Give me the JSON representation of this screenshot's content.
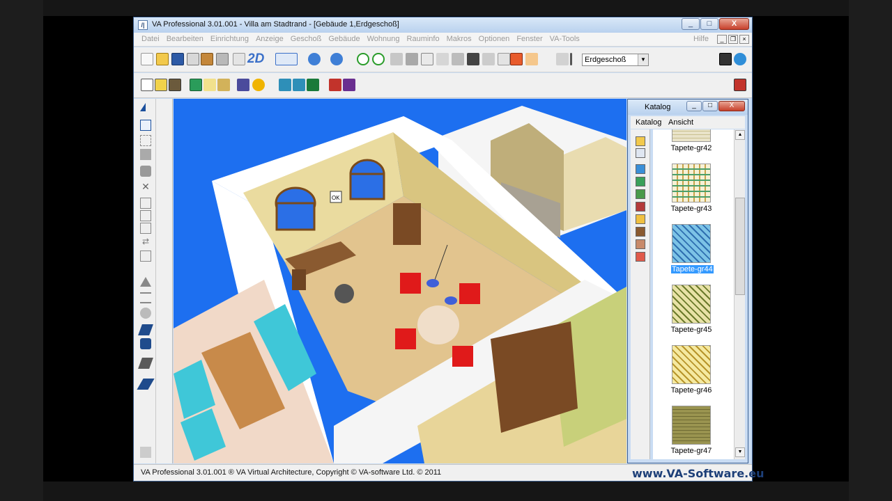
{
  "window": {
    "title": "VA Professional  3.01.001 - Villa am Stadtrand - [Gebäude 1,Erdgeschoß]",
    "min_label": "_",
    "max_label": "□",
    "close_label": "X"
  },
  "menu": {
    "items": [
      "Datei",
      "Bearbeiten",
      "Einrichtung",
      "Anzeige",
      "Geschoß",
      "Gebäude",
      "Wohnung",
      "Rauminfo",
      "Makros",
      "Optionen",
      "Fenster",
      "VA-Tools"
    ],
    "help": "Hilfe"
  },
  "toolbar": {
    "mode_2d": "2D",
    "floor_select": "Erdgeschoß"
  },
  "statusbar": {
    "text": "VA Professional 3.01.001 ® VA Virtual Architecture, Copyright © VA-software Ltd. © 2011",
    "brand": "www.VA-Software.eu"
  },
  "catalog": {
    "title": "Katalog",
    "menu": [
      "Katalog",
      "Ansicht"
    ],
    "items": [
      {
        "label": "Tapete-gr42",
        "pattern": "beige-check"
      },
      {
        "label": "Tapete-gr43",
        "pattern": "green-plaid"
      },
      {
        "label": "Tapete-gr44",
        "pattern": "blue-diamond",
        "selected": true
      },
      {
        "label": "Tapete-gr45",
        "pattern": "olive-diamond"
      },
      {
        "label": "Tapete-gr46",
        "pattern": "yellow-diamond"
      },
      {
        "label": "Tapete-gr47",
        "pattern": "olive-grid"
      }
    ]
  },
  "viewport": {
    "cursor_label": "OK"
  },
  "colors": {
    "sky": "#1d6ff0",
    "wall_top": "#ffffff",
    "wallpaper": "#e7d79b",
    "floor": "#e2c48e",
    "chairs": "#e01a1a",
    "window_blue": "#2b6fe6"
  }
}
